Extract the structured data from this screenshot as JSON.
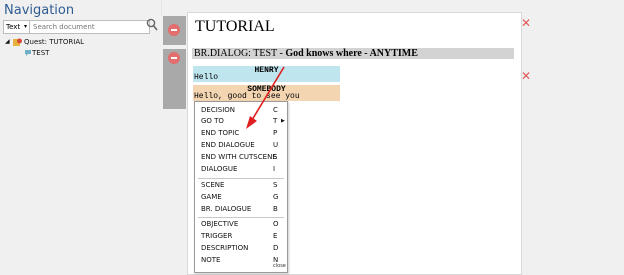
{
  "nav": {
    "title": "Navigation",
    "filter_label": "Text",
    "search_placeholder": "Search document",
    "tree": [
      {
        "label": "Quest: TUTORIAL"
      },
      {
        "label": "TEST"
      }
    ]
  },
  "document": {
    "title": "TUTORIAL",
    "dialog_header": {
      "prefix": "BR.DIALOG: TEST -",
      "bold": "God knows where - ANYTIME"
    },
    "blocks": [
      {
        "speaker": "HENRY",
        "line": "Hello"
      },
      {
        "speaker": "SOMEBODY",
        "line": "Hello, good to see you"
      }
    ]
  },
  "menu": {
    "items": [
      {
        "label": "DECISION",
        "shortcut": "C"
      },
      {
        "label": "GO TO",
        "shortcut": "T"
      },
      {
        "label": "END TOPIC",
        "shortcut": "P"
      },
      {
        "label": "END DIALOGUE",
        "shortcut": "U"
      },
      {
        "label": "END WITH CUTSCENE",
        "shortcut": "S"
      },
      {
        "label": "DIALOGUE",
        "shortcut": "I"
      },
      {
        "label": "SCENE",
        "shortcut": "S"
      },
      {
        "label": "GAME",
        "shortcut": "G"
      },
      {
        "label": "BR. DIALOGUE",
        "shortcut": "B"
      },
      {
        "label": "OBJECTIVE",
        "shortcut": "O"
      },
      {
        "label": "TRIGGER",
        "shortcut": "E"
      },
      {
        "label": "DESCRIPTION",
        "shortcut": "D"
      },
      {
        "label": "NOTE",
        "shortcut": "N"
      }
    ],
    "close_label": "close"
  },
  "colors": {
    "nav_title": "#2f5c92",
    "delete_button": "#e46e6e",
    "close_x": "#e05858",
    "annotation_arrow": "#e02020",
    "henry_bg": "#bfe5ef",
    "somebody_bg": "#f3d5b2"
  }
}
